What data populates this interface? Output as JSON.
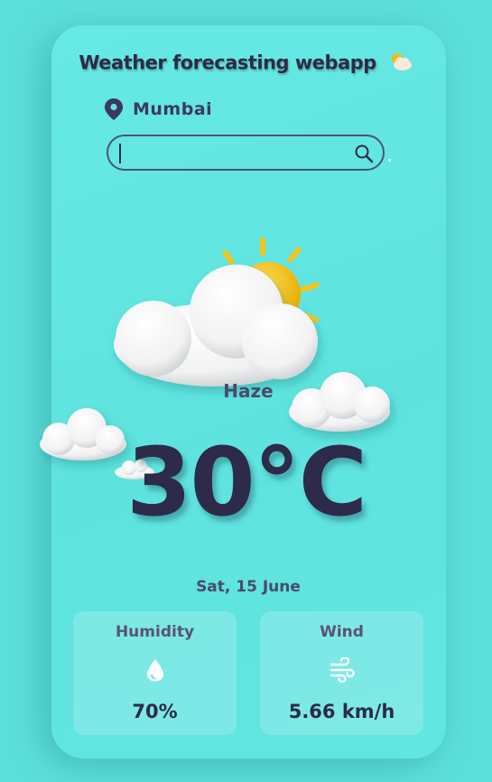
{
  "app": {
    "title": "Weather forecasting webapp",
    "title_emoji": "⛅"
  },
  "location": {
    "city": "Mumbai",
    "icon": "map-pin-icon"
  },
  "search": {
    "value": "",
    "placeholder": "",
    "button_icon": "search-icon"
  },
  "weather": {
    "condition": "Haze",
    "temperature": "30°C",
    "date": "Sat, 15 June",
    "illustration": "sun-behind-clouds"
  },
  "stats": {
    "humidity": {
      "label": "Humidity",
      "value": "70%",
      "icon": "water-drop-icon"
    },
    "wind": {
      "label": "Wind",
      "value": "5.66 km/h",
      "icon": "wind-icon"
    }
  },
  "colors": {
    "background": "#5de0dc",
    "text_dark": "#2d2a4a",
    "text_muted": "#4a4a6a",
    "sun": "#f5c518"
  }
}
